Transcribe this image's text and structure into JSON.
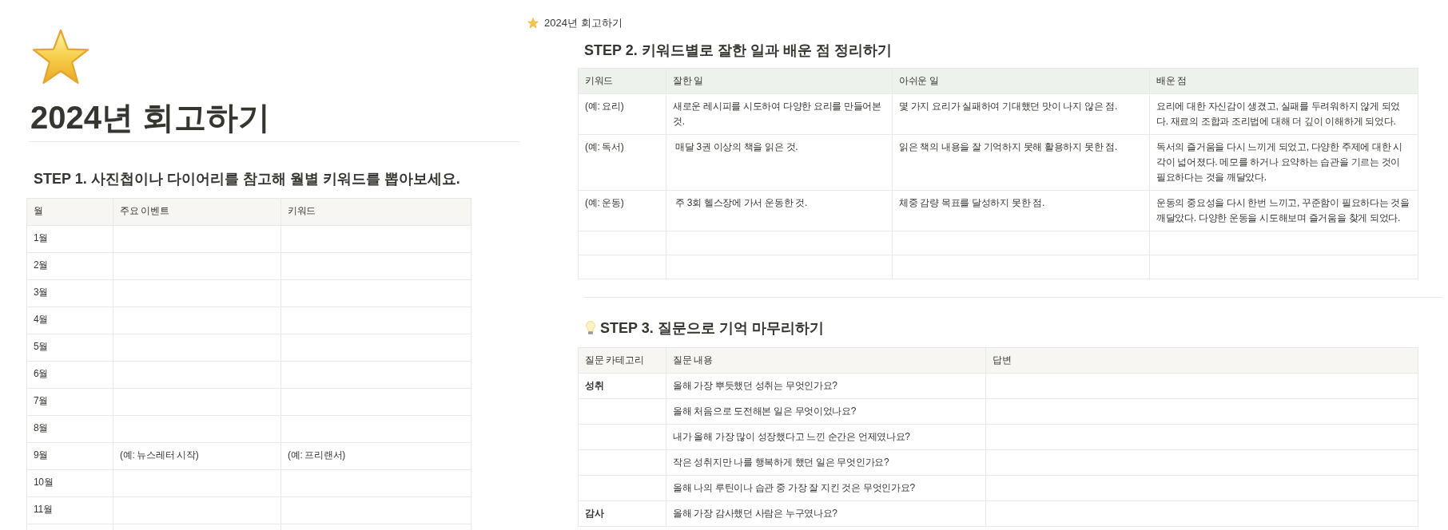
{
  "left_page": {
    "title": "2024년 회고하기",
    "step1": {
      "heading": "STEP 1. 사진첩이나 다이어리를 참고해 월별 키워드를 뽑아보세요.",
      "columns": [
        "월",
        "주요 이벤트",
        "키워드"
      ],
      "rows": [
        {
          "month": "1월"
        },
        {
          "month": "2월"
        },
        {
          "month": "3월"
        },
        {
          "month": "4월"
        },
        {
          "month": "5월"
        },
        {
          "month": "6월"
        },
        {
          "month": "7월"
        },
        {
          "month": "8월"
        },
        {
          "month": "9월",
          "event": "(예: 뉴스레터 시작)",
          "keyword": "(예: 프리랜서)"
        },
        {
          "month": "10월"
        },
        {
          "month": "11월"
        }
      ]
    }
  },
  "right_page": {
    "breadcrumb": "2024년 회고하기",
    "step2": {
      "heading": "STEP 2. 키워드별로 잘한 일과 배운 점 정리하기",
      "columns": [
        "키워드",
        "잘한 일",
        "아쉬운 일",
        "배운 점"
      ],
      "rows": [
        {
          "keyword": "(예: 요리)",
          "did_well": "새로운 레시피를 시도하여 다양한 요리를 만들어본 것.",
          "regret": "몇 가지 요리가 실패하여 기대했던 맛이 나지 않은 점.",
          "learned": "요리에 대한 자신감이 생겼고, 실패를 두려워하지 않게 되었다. 재료의 조합과 조리법에 대해 더 깊이 이해하게 되었다."
        },
        {
          "keyword": "(예: 독서)",
          "did_well": " 매달 3권 이상의 책을 읽은 것.",
          "regret": "읽은 책의 내용을 잘 기억하지 못해 활용하지 못한 점.",
          "learned": "독서의 즐거움을 다시 느끼게 되었고, 다양한 주제에 대한 시각이 넓어졌다. 메모를 하거나 요약하는 습관을 기르는 것이 필요하다는 것을 깨달았다."
        },
        {
          "keyword": "(예: 운동)",
          "did_well": " 주 3회 헬스장에 가서 운동한 것.",
          "regret": "체중 감량 목표를 달성하지 못한 점.",
          "learned": "운동의 중요성을 다시 한번 느끼고, 꾸준함이 필요하다는 것을 깨달았다. 다양한 운동을 시도해보며 즐거움을 찾게 되었다."
        }
      ]
    },
    "step3": {
      "heading": "STEP 3. 질문으로 기억 마무리하기",
      "columns": [
        "질문 카테고리",
        "질문 내용",
        "답변"
      ],
      "rows": [
        {
          "category": "성취",
          "question": "올해 가장 뿌듯했던 성취는 무엇인가요?"
        },
        {
          "question": "올해 처음으로 도전해본 일은 무엇이었나요?"
        },
        {
          "question": "내가 올해 가장 많이 성장했다고 느낀 순간은 언제였나요?"
        },
        {
          "question": "작은 성취지만 나를 행복하게 했던 일은 무엇인가요?"
        },
        {
          "question": "올해 나의 루틴이나 습관 중 가장 잘 지킨 것은 무엇인가요?"
        },
        {
          "category": "감사",
          "question": "올해 가장 감사했던 사람은 누구였나요?"
        }
      ]
    }
  }
}
